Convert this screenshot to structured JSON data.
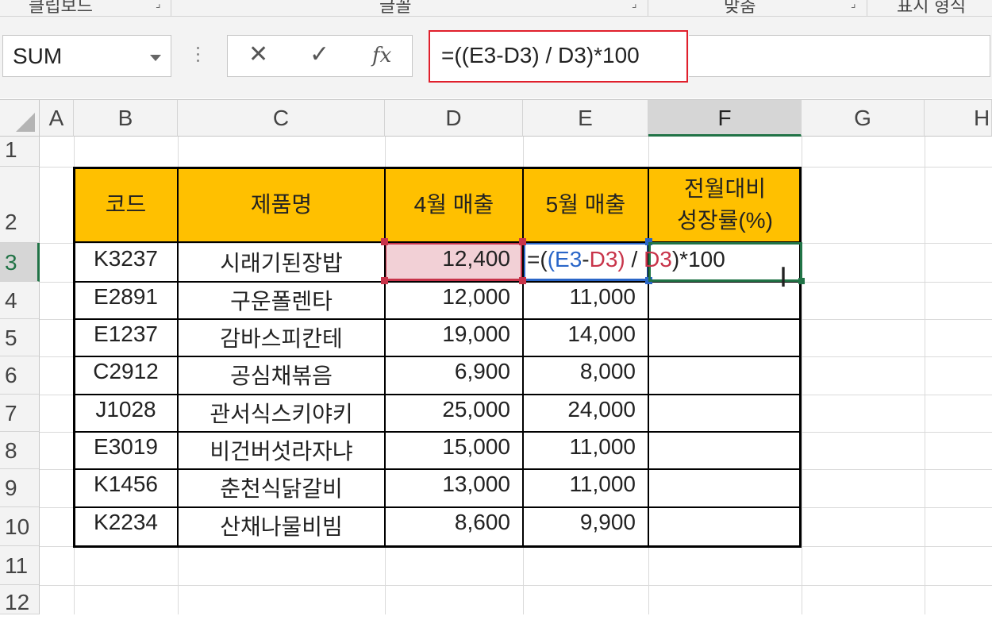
{
  "ribbon": {
    "groups": [
      "클립보드",
      "글꼴",
      "맞춤",
      "표시 형식"
    ]
  },
  "formula_bar": {
    "name_box": "SUM",
    "cancel_icon": "✕",
    "enter_icon": "✓",
    "fx_label": "fx",
    "formula": "=((E3-D3) / D3)*100"
  },
  "columns": [
    "A",
    "B",
    "C",
    "D",
    "E",
    "F",
    "G",
    "H"
  ],
  "rows": [
    "1",
    "2",
    "3",
    "4",
    "5",
    "6",
    "7",
    "8",
    "9",
    "10",
    "11",
    "12"
  ],
  "table": {
    "headers": [
      "코드",
      "제품명",
      "4월 매출",
      "5월 매출",
      "전월대비",
      "성장률(%)"
    ],
    "data": [
      [
        "K3237",
        "시래기된장밥",
        "12,400",
        ""
      ],
      [
        "E2891",
        "구운폴렌타",
        "12,000",
        "11,000"
      ],
      [
        "E1237",
        "감바스피칸테",
        "19,000",
        "14,000"
      ],
      [
        "C2912",
        "공심채볶음",
        "6,900",
        "8,000"
      ],
      [
        "J1028",
        "관서식스키야키",
        "25,000",
        "24,000"
      ],
      [
        "E3019",
        "비건버섯라자냐",
        "15,000",
        "11,000"
      ],
      [
        "K1456",
        "춘천식닭갈비",
        "13,000",
        "11,000"
      ],
      [
        "K2234",
        "산채나물비빔",
        "8,600",
        "9,900"
      ]
    ]
  },
  "edit_formula": {
    "p1": "=(",
    "p2": "(",
    "e3": "E3",
    "minus": "-",
    "d3a": "D3",
    "p3": ")",
    "slash": " / ",
    "d3b": "D3",
    "p4": ")*100"
  },
  "colors": {
    "header_fill": "#ffc000",
    "ref_d3": "#c8344a",
    "ref_e3": "#2a66c8",
    "active_cell": "#217346",
    "formula_box_highlight": "#e0202c"
  }
}
